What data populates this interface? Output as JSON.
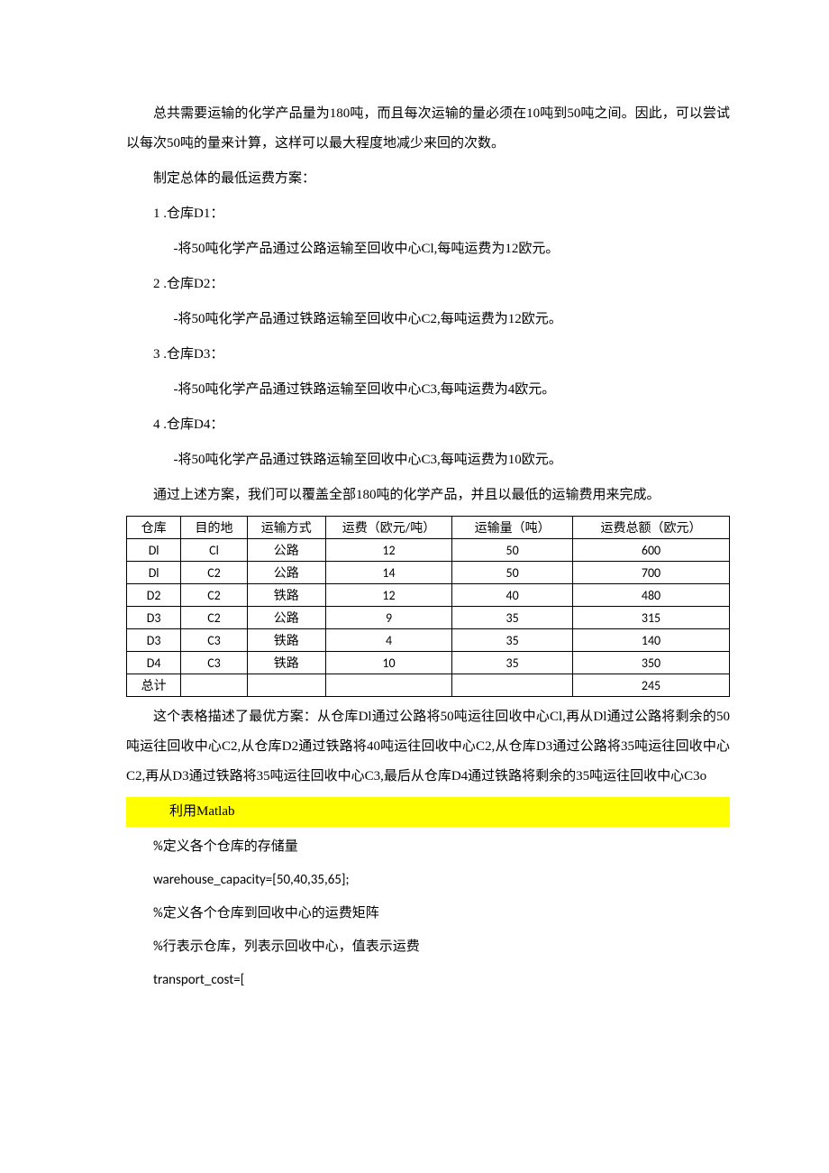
{
  "p1": "总共需要运输的化学产品量为180吨，而且每次运输的量必须在10吨到50吨之间。因此，可以尝试以每次50吨的量来计算，这样可以最大程度地减少来回的次数。",
  "p2": "制定总体的最低运费方案：",
  "items": {
    "i1": "1 .仓库D1：",
    "i1s": "-将50吨化学产品通过公路运输至回收中心Cl,每吨运费为12欧元。",
    "i2": "2 .仓库D2：",
    "i2s": "-将50吨化学产品通过铁路运输至回收中心C2,每吨运费为12欧元。",
    "i3": "3 .仓库D3：",
    "i3s": "-将50吨化学产品通过铁路运输至回收中心C3,每吨运费为4欧元。",
    "i4": "4 .仓库D4：",
    "i4s": "-将50吨化学产品通过铁路运输至回收中心C3,每吨运费为10欧元。"
  },
  "p3": "通过上述方案，我们可以覆盖全部180吨的化学产品，并且以最低的运输费用来完成。",
  "table": {
    "headers": [
      "仓库",
      "目的地",
      "运输方式",
      "运费（欧元/吨）",
      "运输量（吨）",
      "运费总额（欧元）"
    ],
    "rows": [
      [
        "Dl",
        "Cl",
        "公路",
        "12",
        "50",
        "600"
      ],
      [
        "Dl",
        "C2",
        "公路",
        "14",
        "50",
        "700"
      ],
      [
        "D2",
        "C2",
        "铁路",
        "12",
        "40",
        "480"
      ],
      [
        "D3",
        "C2",
        "公路",
        "9",
        "35",
        "315"
      ],
      [
        "D3",
        "C3",
        "铁路",
        "4",
        "35",
        "140"
      ],
      [
        "D4",
        "C3",
        "铁路",
        "10",
        "35",
        "350"
      ],
      [
        "总计",
        "",
        "",
        "",
        "",
        "245"
      ]
    ]
  },
  "p4": "这个表格描述了最优方案：从仓库Dl通过公路将50吨运往回收中心Cl,再从Dl通过公路将剩余的50吨运往回收中心C2,从仓库D2通过铁路将40吨运往回收中心C2,从仓库D3通过公路将35吨运往回收中心C2,再从D3通过铁路将35吨运往回收中心C3,最后从仓库D4通过铁路将剩余的35吨运往回收中心C3o",
  "hl": "利用Matlab",
  "code": {
    "c1": "%定义各个仓库的存储量",
    "c2": "warehouse_capacity=[50,40,35,65];",
    "c3": "%定义各个仓库到回收中心的运费矩阵",
    "c4": "%行表示仓库，列表示回收中心，值表示运费",
    "c5": "transport_cost=["
  }
}
